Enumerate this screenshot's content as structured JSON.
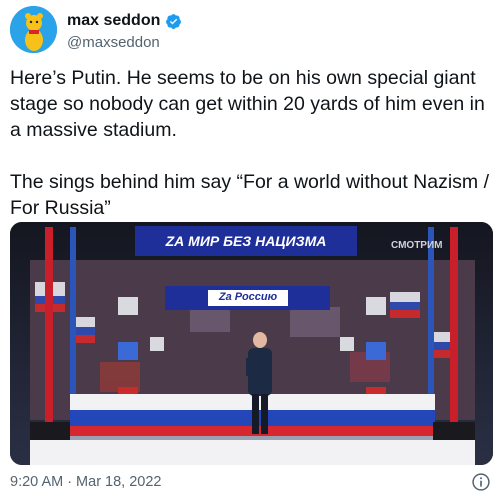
{
  "author": {
    "name": "max seddon",
    "handle": "@maxseddon",
    "verified": true
  },
  "tweet": {
    "text": "Here’s Putin. He seems to be on his own special giant stage so nobody can get within 20 yards of him even in a massive stadium.\n\nThe sings behind him say “For a world without Nazism / For Russia”",
    "time": "9:20 AM",
    "separator": "·",
    "date": "Mar 18, 2022"
  },
  "media": {
    "banner_top": "Zа мир без нацизма",
    "banner_bottom": "Zа Россию",
    "logo": "СМОТРИМ"
  },
  "colors": {
    "verified": "#1d9bf0",
    "avatar_bg": "#2aa3e8",
    "banner_blue": "#1f2f9a",
    "banner_red": "#e0242f"
  },
  "icons": [
    "verified-badge-icon",
    "info-icon"
  ]
}
